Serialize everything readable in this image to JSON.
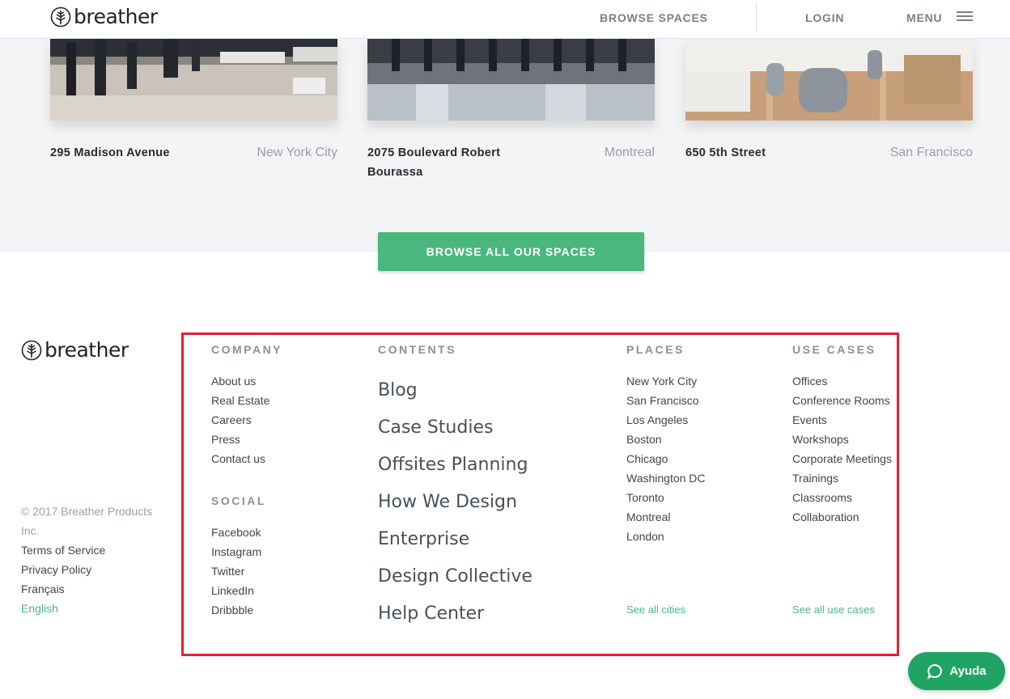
{
  "brand": {
    "name": "breather",
    "accent": "#4ab77f"
  },
  "nav": {
    "browse": "BROWSE SPACES",
    "login": "LOGIN",
    "menu": "MENU"
  },
  "spaces": [
    {
      "name": "295 Madison Avenue",
      "city": "New York City"
    },
    {
      "name": "2075 Boulevard Robert Bourassa",
      "city": "Montreal"
    },
    {
      "name": "650 5th Street",
      "city": "San Francisco"
    }
  ],
  "cta": {
    "label": "BROWSE ALL OUR SPACES"
  },
  "footer": {
    "legal": {
      "copyright": "© 2017 Breather Products Inc.",
      "terms": "Terms of Service",
      "privacy": "Privacy Policy",
      "french": "Français",
      "english": "English"
    },
    "company": {
      "heading": "COMPANY",
      "items": [
        "About us",
        "Real Estate",
        "Careers",
        "Press",
        "Contact us"
      ]
    },
    "social": {
      "heading": "SOCIAL",
      "items": [
        "Facebook",
        "Instagram",
        "Twitter",
        "LinkedIn",
        "Dribbble"
      ]
    },
    "contents": {
      "heading": "CONTENTS",
      "items": [
        "Blog",
        "Case Studies",
        "Offsites Planning",
        "How We Design",
        "Enterprise",
        "Design Collective",
        "Help Center"
      ]
    },
    "places": {
      "heading": "PLACES",
      "items": [
        "New York City",
        "San Francisco",
        "Los Angeles",
        "Boston",
        "Chicago",
        "Washington DC",
        "Toronto",
        "Montreal",
        "London"
      ],
      "see_all": "See all cities"
    },
    "use_cases": {
      "heading": "USE CASES",
      "items": [
        "Offices",
        "Conference Rooms",
        "Events",
        "Workshops",
        "Corporate Meetings",
        "Trainings",
        "Classrooms",
        "Collaboration"
      ],
      "see_all": "See all use cases"
    }
  },
  "help": {
    "label": "Ayuda"
  },
  "colors": {
    "highlight_border": "#e3202e",
    "help_button": "#1fa463"
  }
}
